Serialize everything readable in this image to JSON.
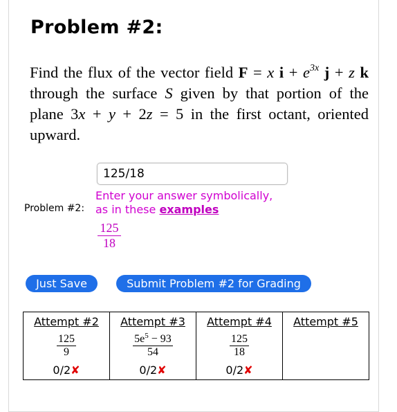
{
  "problem": {
    "title": "Problem #2:",
    "label": "Problem #2:",
    "answer_value": "125/18",
    "hint_line1": "Enter your answer symbolically,",
    "hint_line2": "as in these",
    "hint_link": "examples",
    "preview": {
      "numerator": "125",
      "denominator": "18"
    }
  },
  "buttons": {
    "save": "Just Save",
    "submit": "Submit Problem #2 for Grading"
  },
  "attempts": [
    {
      "header": "Attempt #2",
      "numerator": "125",
      "denominator": "9",
      "score": "0/2",
      "mark": "✘"
    },
    {
      "header": "Attempt #3",
      "numerator": "5e",
      "numerator_exp": "5",
      "numerator_tail": " − 93",
      "denominator": "54",
      "score": "0/2",
      "mark": "✘"
    },
    {
      "header": "Attempt #4",
      "numerator": "125",
      "denominator": "18",
      "score": "0/2",
      "mark": "✘"
    },
    {
      "header": "Attempt #5",
      "numerator": "",
      "denominator": "",
      "score": "",
      "mark": ""
    }
  ],
  "colors": {
    "accent": "#1f6fe8",
    "hint": "#d000d0",
    "error": "#e00000"
  }
}
